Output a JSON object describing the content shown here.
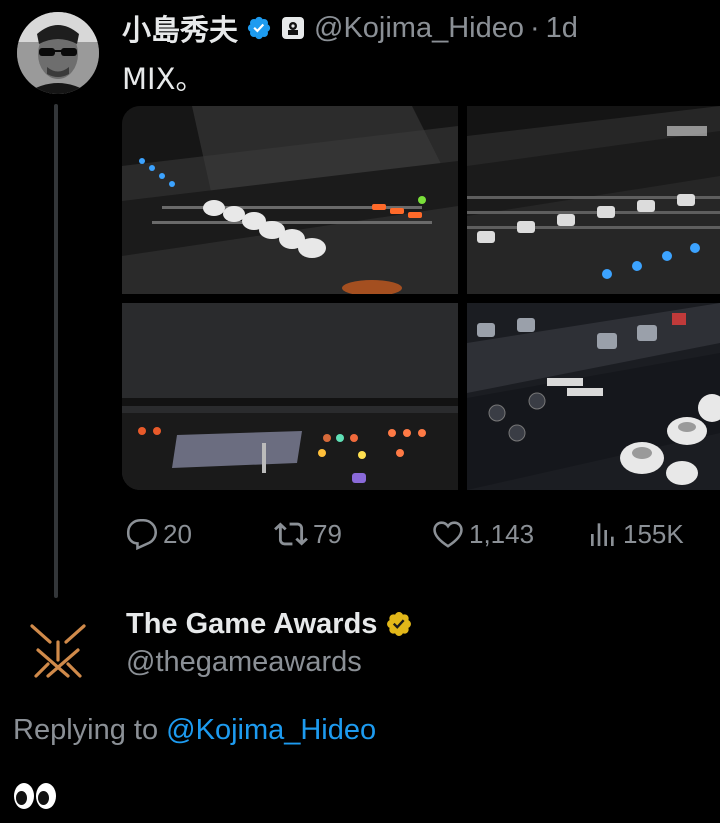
{
  "tweet": {
    "author": {
      "display_name": "小島秀夫",
      "handle": "@Kojima_Hideo",
      "verified": true,
      "affiliate_badge": "kojima-productions-logo-icon"
    },
    "separator": "·",
    "time_ago": "1d",
    "text": "MIX。",
    "media": [
      {
        "name": "mixing-console-faders-photo"
      },
      {
        "name": "mixing-console-overview-photo"
      },
      {
        "name": "console-lit-buttons-photo"
      },
      {
        "name": "rack-knobs-photo"
      }
    ],
    "stats": {
      "replies": "20",
      "retweets": "79",
      "likes": "1,143",
      "views": "155K"
    },
    "colors": {
      "accent": "#1d9bf0",
      "muted_text": "#8b9096",
      "primary_text": "#e7e9ea",
      "background": "#000000"
    }
  },
  "reply": {
    "author": {
      "display_name": "The Game Awards",
      "handle": "@thegameawards",
      "badge": "gold-verified-badge",
      "logo_color": "#d08a4a"
    },
    "replying_prefix": "Replying to",
    "replying_to": "@Kojima_Hideo",
    "text_emoji": "eyes-emoji"
  }
}
